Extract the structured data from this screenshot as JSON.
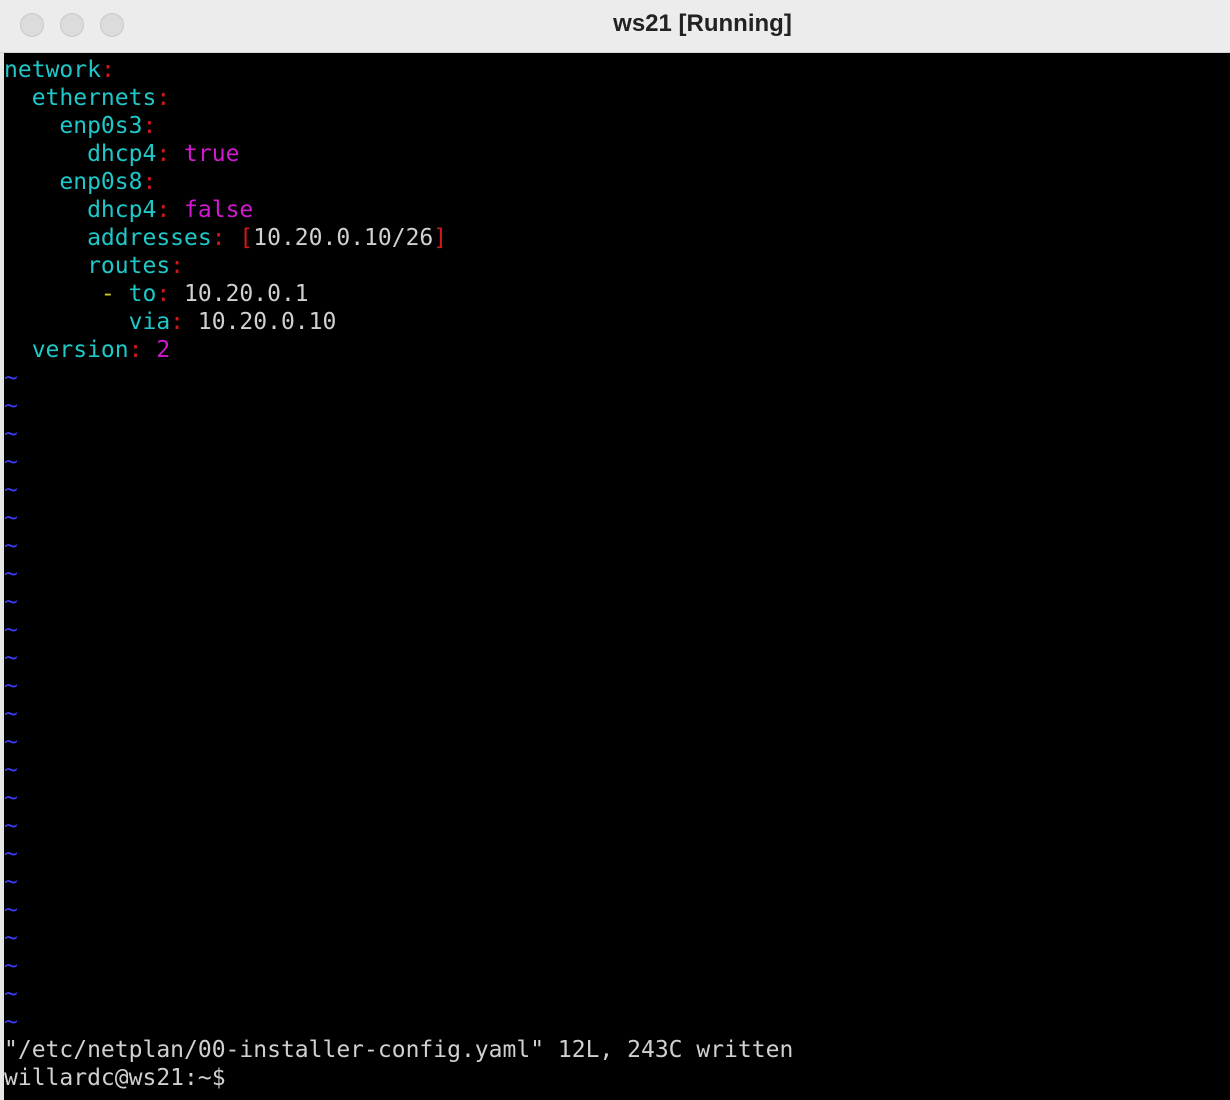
{
  "window": {
    "title": "ws21 [Running]"
  },
  "editor": {
    "lines": [
      [
        {
          "t": "network",
          "c": "cyan"
        },
        {
          "t": ":",
          "c": "red"
        }
      ],
      [
        {
          "t": "  ethernets",
          "c": "cyan"
        },
        {
          "t": ":",
          "c": "red"
        }
      ],
      [
        {
          "t": "    enp0s3",
          "c": "cyan"
        },
        {
          "t": ":",
          "c": "red"
        }
      ],
      [
        {
          "t": "      dhcp4",
          "c": "cyan"
        },
        {
          "t": ": ",
          "c": "red"
        },
        {
          "t": "true",
          "c": "mag"
        }
      ],
      [
        {
          "t": "    enp0s8",
          "c": "cyan"
        },
        {
          "t": ":",
          "c": "red"
        }
      ],
      [
        {
          "t": "      dhcp4",
          "c": "cyan"
        },
        {
          "t": ": ",
          "c": "red"
        },
        {
          "t": "false",
          "c": "mag"
        }
      ],
      [
        {
          "t": "      addresses",
          "c": "cyan"
        },
        {
          "t": ": [",
          "c": "red"
        },
        {
          "t": "10.20.0.10/26",
          "c": "white"
        },
        {
          "t": "]",
          "c": "red"
        }
      ],
      [
        {
          "t": "      routes",
          "c": "cyan"
        },
        {
          "t": ":",
          "c": "red"
        }
      ],
      [
        {
          "t": "       - ",
          "c": "yel"
        },
        {
          "t": "to",
          "c": "cyan"
        },
        {
          "t": ": ",
          "c": "red"
        },
        {
          "t": "10.20.0.1",
          "c": "white"
        }
      ],
      [
        {
          "t": "         via",
          "c": "cyan"
        },
        {
          "t": ": ",
          "c": "red"
        },
        {
          "t": "10.20.0.10",
          "c": "white"
        }
      ],
      [
        {
          "t": "  version",
          "c": "cyan"
        },
        {
          "t": ": ",
          "c": "red"
        },
        {
          "t": "2",
          "c": "mag"
        }
      ]
    ],
    "empty_line_marker": "~",
    "empty_line_count": 24
  },
  "status_line": "\"/etc/netplan/00-installer-config.yaml\" 12L, 243C written",
  "shell_prompt": "willardc@ws21:~$"
}
